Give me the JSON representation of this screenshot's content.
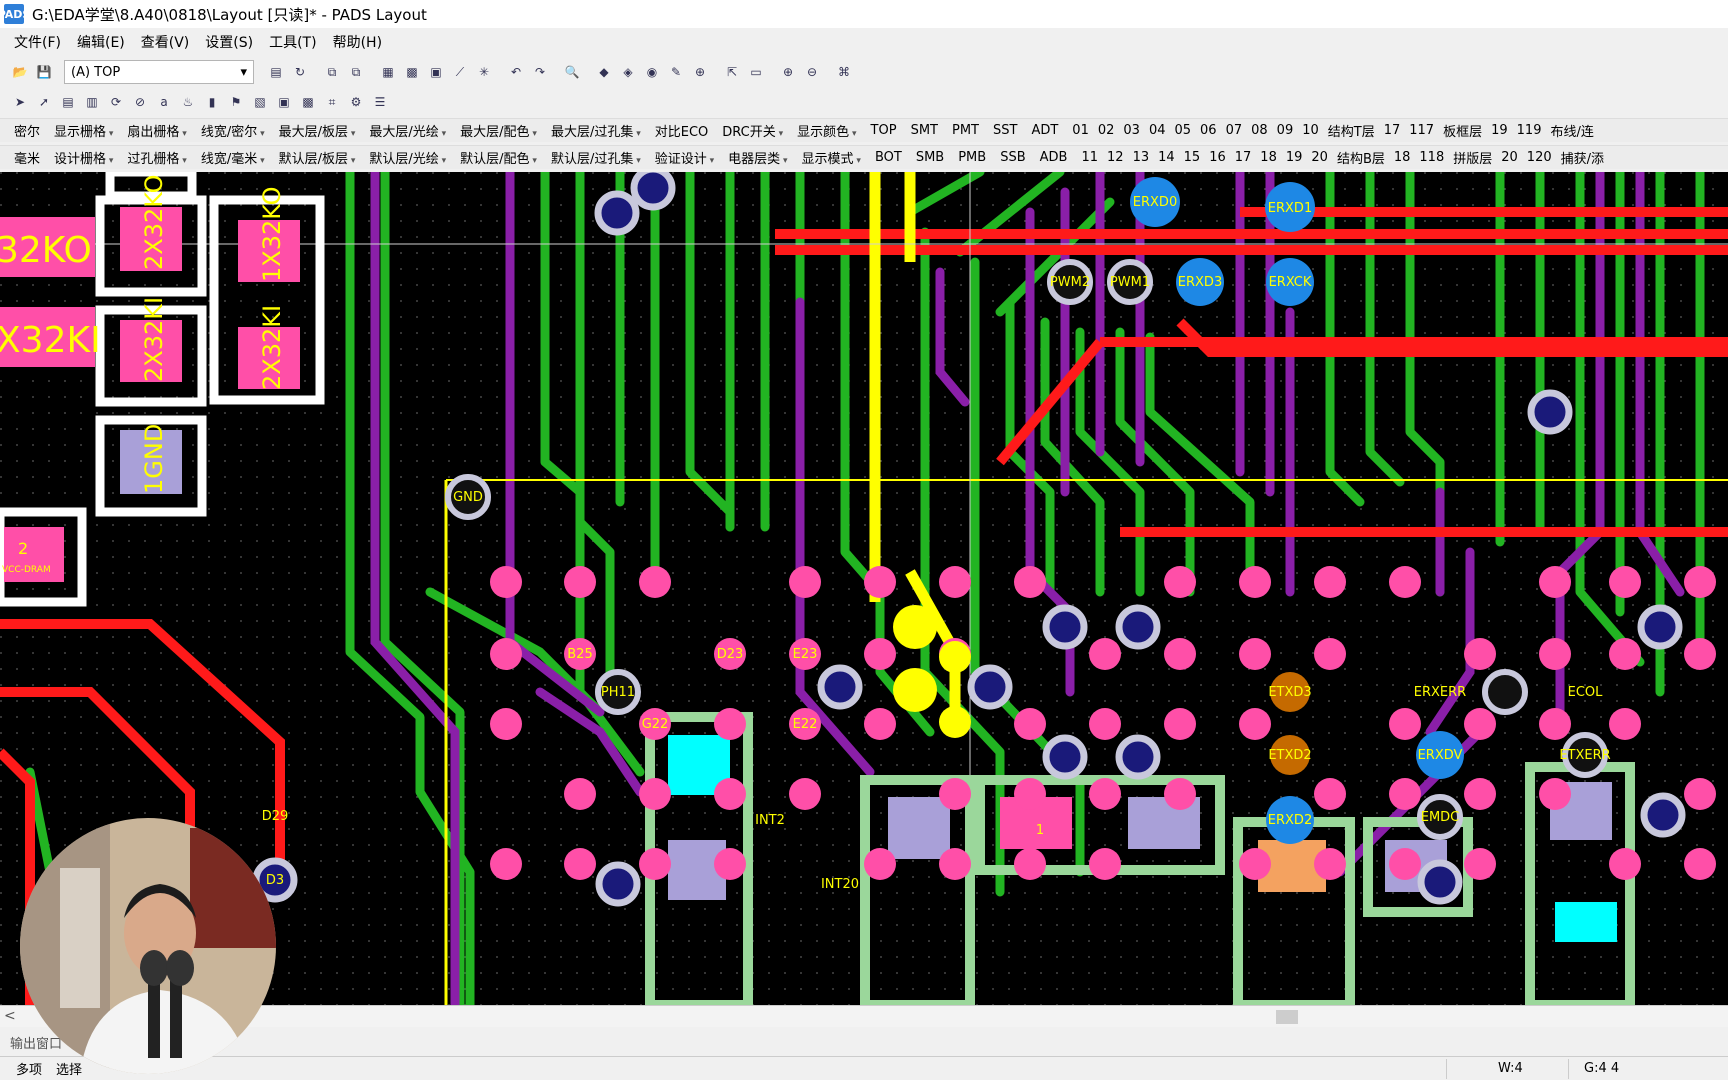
{
  "window": {
    "app_icon": "PADS",
    "title": "G:\\EDA学堂\\8.A40\\0818\\Layout [只读]* - PADS Layout"
  },
  "menu": [
    "文件(F)",
    "编辑(E)",
    "查看(V)",
    "设置(S)",
    "工具(T)",
    "帮助(H)"
  ],
  "toolbar": {
    "layer_select": "(A) TOP",
    "dropdown_arrow": "▾"
  },
  "options_row1": {
    "unit": "密尔",
    "dropdowns": [
      "显示栅格",
      "扇出栅格",
      "线宽/密尔",
      "最大层/板层",
      "最大层/光绘",
      "最大层/配色",
      "最大层/过孔集",
      "对比ECO",
      "DRC开关",
      "显示颜色"
    ],
    "layers": [
      "TOP",
      "SMT",
      "PMT",
      "SST",
      "ADT"
    ],
    "numbers": [
      "01",
      "02",
      "03",
      "04",
      "05",
      "06",
      "07",
      "08",
      "09",
      "10"
    ],
    "tail": [
      "结构T层",
      "17",
      "117",
      "板框层",
      "19",
      "119",
      "布线/连"
    ]
  },
  "options_row2": {
    "unit": "毫米",
    "dropdowns": [
      "设计栅格",
      "过孔栅格",
      "线宽/毫米",
      "默认层/板层",
      "默认层/光绘",
      "默认层/配色",
      "默认层/过孔集",
      "验证设计",
      "电器层类",
      "显示模式"
    ],
    "layers": [
      "BOT",
      "SMB",
      "PMB",
      "SSB",
      "ADB"
    ],
    "numbers": [
      "11",
      "12",
      "13",
      "14",
      "15",
      "16",
      "17",
      "18",
      "19",
      "20"
    ],
    "tail": [
      "结构B层",
      "18",
      "118",
      "拼版层",
      "20",
      "120",
      "捕获/添"
    ]
  },
  "pcb": {
    "colors": {
      "background": "#000000",
      "green_trace": "#22b422",
      "purple_trace": "#8a1fa8",
      "red_trace": "#ff1a1a",
      "yellow": "#ffff00",
      "pad_pink": "#ff4fa8",
      "via_blue": "#1a1a7a",
      "via_ring": "#c8c8dc",
      "white_outline": "#ffffff",
      "component_fill": "#ff4fa8"
    },
    "components": [
      "32KO",
      "X32KI",
      "2X32KO",
      "1X32KO",
      "2X32KI",
      "2X32KI",
      "1GND",
      "2"
    ],
    "small_label": "VCC-DRAM",
    "pad_labels": [
      "GND",
      "ERXD0",
      "ERXD1",
      "ERXD3",
      "ERXCK",
      "PWM1",
      "PWM2",
      "PH11",
      "ETXD3",
      "ETXD2",
      "ERXD2",
      "ERXDV",
      "ERXERR",
      "ECOL",
      "ETXERR",
      "EMDC",
      "INT2",
      "INT20",
      "B25",
      "D23",
      "E23",
      "E22",
      "G22",
      "D29",
      "D3",
      "1"
    ]
  },
  "scroll": {
    "left_arrow": "<"
  },
  "output_window": "输出窗口",
  "status": {
    "mode": "多项",
    "selection": "选择",
    "width": "W:4",
    "grid": "G:4 4"
  },
  "webcam": {
    "label": "presenter webcam"
  }
}
